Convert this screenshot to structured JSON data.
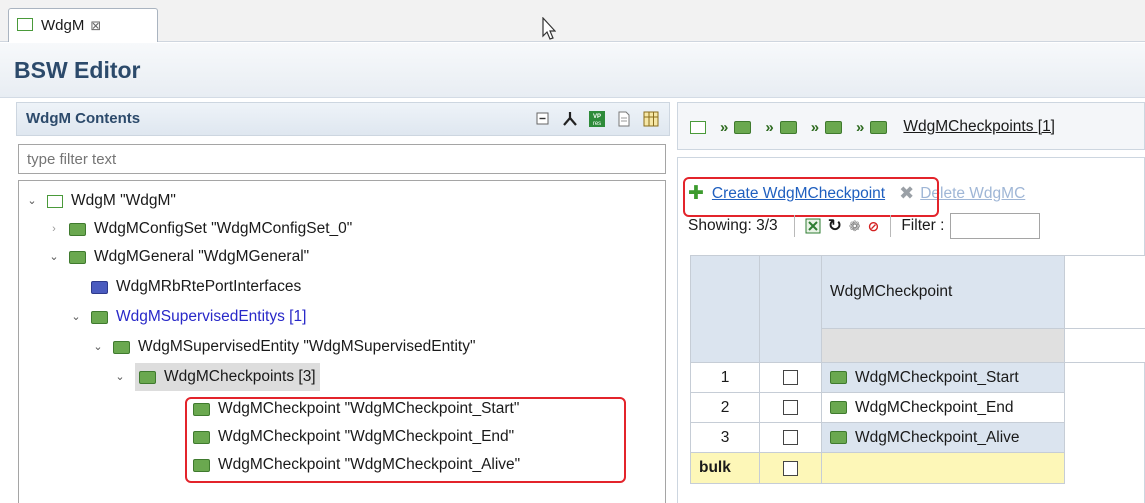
{
  "tab": {
    "label": "WdgM",
    "close_glyph": "⊠"
  },
  "editor": {
    "title": "BSW Editor"
  },
  "left_pane": {
    "title": "WdgM Contents",
    "filter_placeholder": "type filter text",
    "toolbar_icons": [
      "collapse-all-icon",
      "hierarchy-icon",
      "vp-res-icon",
      "document-icon",
      "table-icon"
    ],
    "vp_badge_top": "VP",
    "vp_badge_bottom": "res"
  },
  "tree": [
    {
      "label": "WdgM \"WdgM\"",
      "expanded": true,
      "icon": "module-icon"
    },
    {
      "label": "WdgMConfigSet \"WdgMConfigSet_0\"",
      "expanded": false,
      "icon": "folder-icon"
    },
    {
      "label": "WdgMGeneral \"WdgMGeneral\"",
      "expanded": true,
      "icon": "folder-icon"
    },
    {
      "label": "WdgMRbRtePortInterfaces",
      "icon": "folder-blue-icon"
    },
    {
      "label": "WdgMSupervisedEntitys [1]",
      "expanded": true,
      "icon": "folder-icon"
    },
    {
      "label": "WdgMSupervisedEntity \"WdgMSupervisedEntity\"",
      "expanded": true,
      "icon": "folder-icon"
    },
    {
      "label": "WdgMCheckpoints [3]",
      "expanded": true,
      "icon": "folder-icon",
      "selected": true
    },
    {
      "label": "WdgMCheckpoint \"WdgMCheckpoint_Start\"",
      "icon": "folder-icon"
    },
    {
      "label": "WdgMCheckpoint \"WdgMCheckpoint_End\"",
      "icon": "folder-icon"
    },
    {
      "label": "WdgMCheckpoint \"WdgMCheckpoint_Alive\"",
      "icon": "folder-icon"
    }
  ],
  "right_pane": {
    "breadcrumb_link": "WdgMCheckpoints [1]",
    "create_label": "Create WdgMCheckpoint",
    "delete_label": "Delete WdgMC",
    "showing": "Showing: 3/3",
    "filter_label": "Filter :",
    "filter_value": ""
  },
  "table": {
    "column_header": "WdgMCheckpoint",
    "rows": [
      {
        "index": "1",
        "name": "WdgMCheckpoint_Start"
      },
      {
        "index": "2",
        "name": "WdgMCheckpoint_End"
      },
      {
        "index": "3",
        "name": "WdgMCheckpoint_Alive"
      }
    ],
    "bulk_label": "bulk"
  },
  "colors": {
    "highlight_red": "#e3242b",
    "folder_green": "#6aa84f",
    "link_blue": "#1f5fbf",
    "header_blue": "#dbe4ef",
    "bulk_yellow": "#fdf7b8"
  }
}
